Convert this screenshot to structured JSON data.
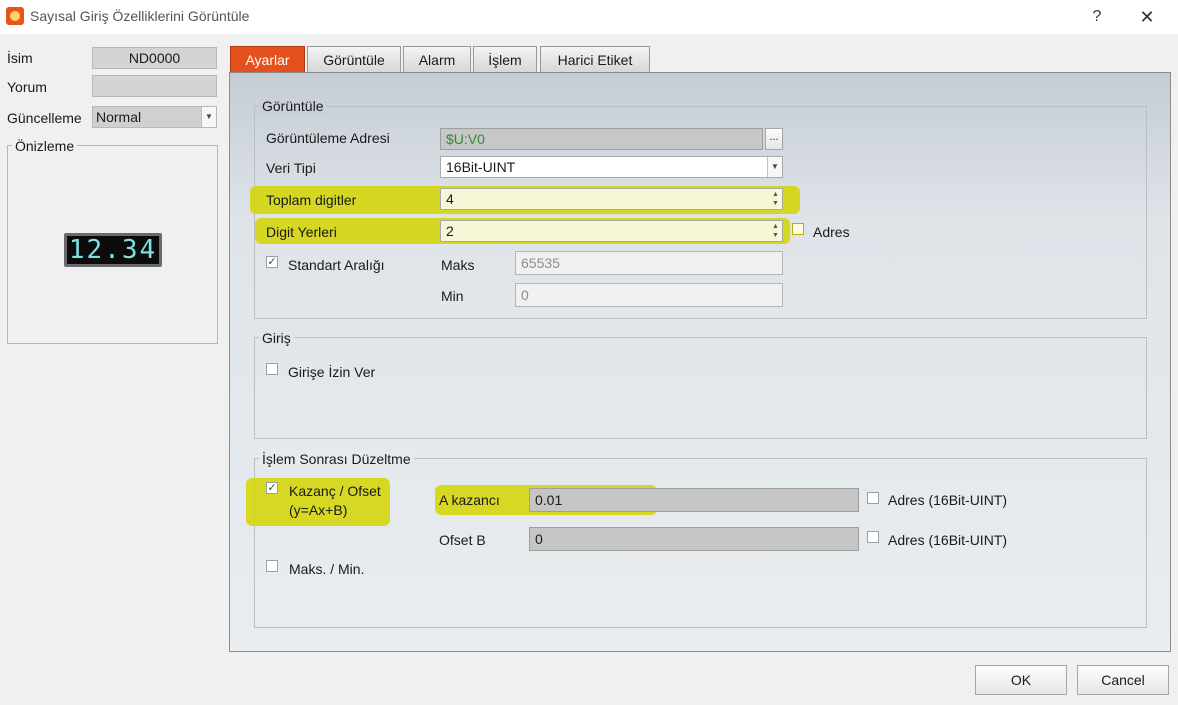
{
  "window": {
    "title": "Sayısal Giriş Özelliklerini Görüntüle",
    "help_glyph": "?",
    "close_glyph": "✕"
  },
  "left": {
    "name_label": "İsim",
    "name_value": "ND0000",
    "comment_label": "Yorum",
    "comment_value": "",
    "update_label": "Güncelleme",
    "update_value": "Normal",
    "preview_label": "Önizleme",
    "preview_value": "12.34"
  },
  "tabs": [
    {
      "label": "Ayarlar",
      "active": true
    },
    {
      "label": "Görüntüle",
      "active": false
    },
    {
      "label": "Alarm",
      "active": false
    },
    {
      "label": "İşlem",
      "active": false
    },
    {
      "label": "Harici Etiket",
      "active": false
    }
  ],
  "display_group": {
    "title": "Görüntüle",
    "address_label": "Görüntüleme Adresi",
    "address_value": "$U:V0",
    "browse_label": "...",
    "datatype_label": "Veri Tipi",
    "datatype_value": "16Bit-UINT",
    "total_digits_label": "Toplam digitler",
    "total_digits_value": "4",
    "digit_places_label": "Digit Yerleri",
    "digit_places_value": "2",
    "address_check_label": "Adres",
    "standard_range_label": "Standart Aralığı",
    "standard_range_checked": true,
    "max_label": "Maks",
    "max_value": "65535",
    "min_label": "Min",
    "min_value": "0"
  },
  "input_group": {
    "title": "Giriş",
    "allow_input_label": "Girişe İzin Ver",
    "allow_input_checked": false
  },
  "post_group": {
    "title": "İşlem Sonrası Düzeltme",
    "gain_offset_label": "Kazanç / Ofset",
    "gain_offset_formula": "(y=Ax+B)",
    "gain_offset_checked": true,
    "a_gain_label": "A kazancı",
    "a_gain_value": "0.01",
    "a_address_label": "Adres (16Bit-UINT)",
    "offset_b_label": "Ofset B",
    "offset_b_value": "0",
    "b_address_label": "Adres (16Bit-UINT)",
    "max_min_label": "Maks. / Min.",
    "max_min_checked": false
  },
  "buttons": {
    "ok": "OK",
    "cancel": "Cancel"
  },
  "colors": {
    "active_tab": "#e6501c",
    "highlight": "#d3d500",
    "address_text": "#2e8b3a",
    "seven_seg": "#7be3e0"
  }
}
